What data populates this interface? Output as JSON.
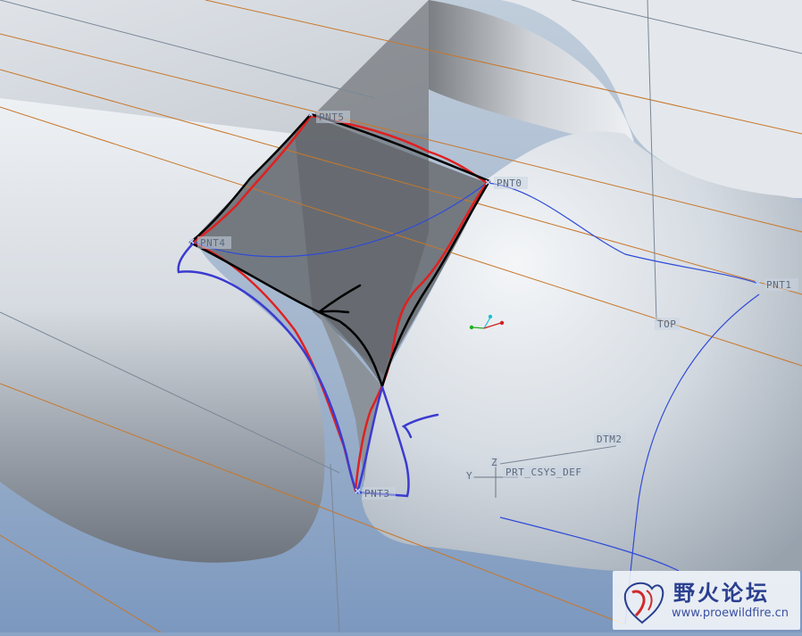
{
  "datum_points": [
    {
      "id": "pnt5",
      "label": "PNT5"
    },
    {
      "id": "pnt0",
      "label": "PNT0"
    },
    {
      "id": "pnt4",
      "label": "PNT4"
    },
    {
      "id": "pnt1",
      "label": "PNT1"
    },
    {
      "id": "pnt3",
      "label": "PNT3"
    }
  ],
  "datum_planes": {
    "top": "TOP",
    "dtm2": "DTM2"
  },
  "coordinate_system": "PRT_CSYS_DEF",
  "watermark": {
    "title": "野火论坛",
    "url": "www.proewildfire.cn"
  },
  "colors": {
    "background": "#8aa4c6",
    "surface": "#d8dde3",
    "shadow_face": "#6b6f74",
    "datum_line": "#c8772a",
    "curve_blue": "#2f4bd8",
    "annotation_red": "#e02020",
    "annotation_black": "#000000",
    "annotation_blue": "#3b3bd0"
  }
}
